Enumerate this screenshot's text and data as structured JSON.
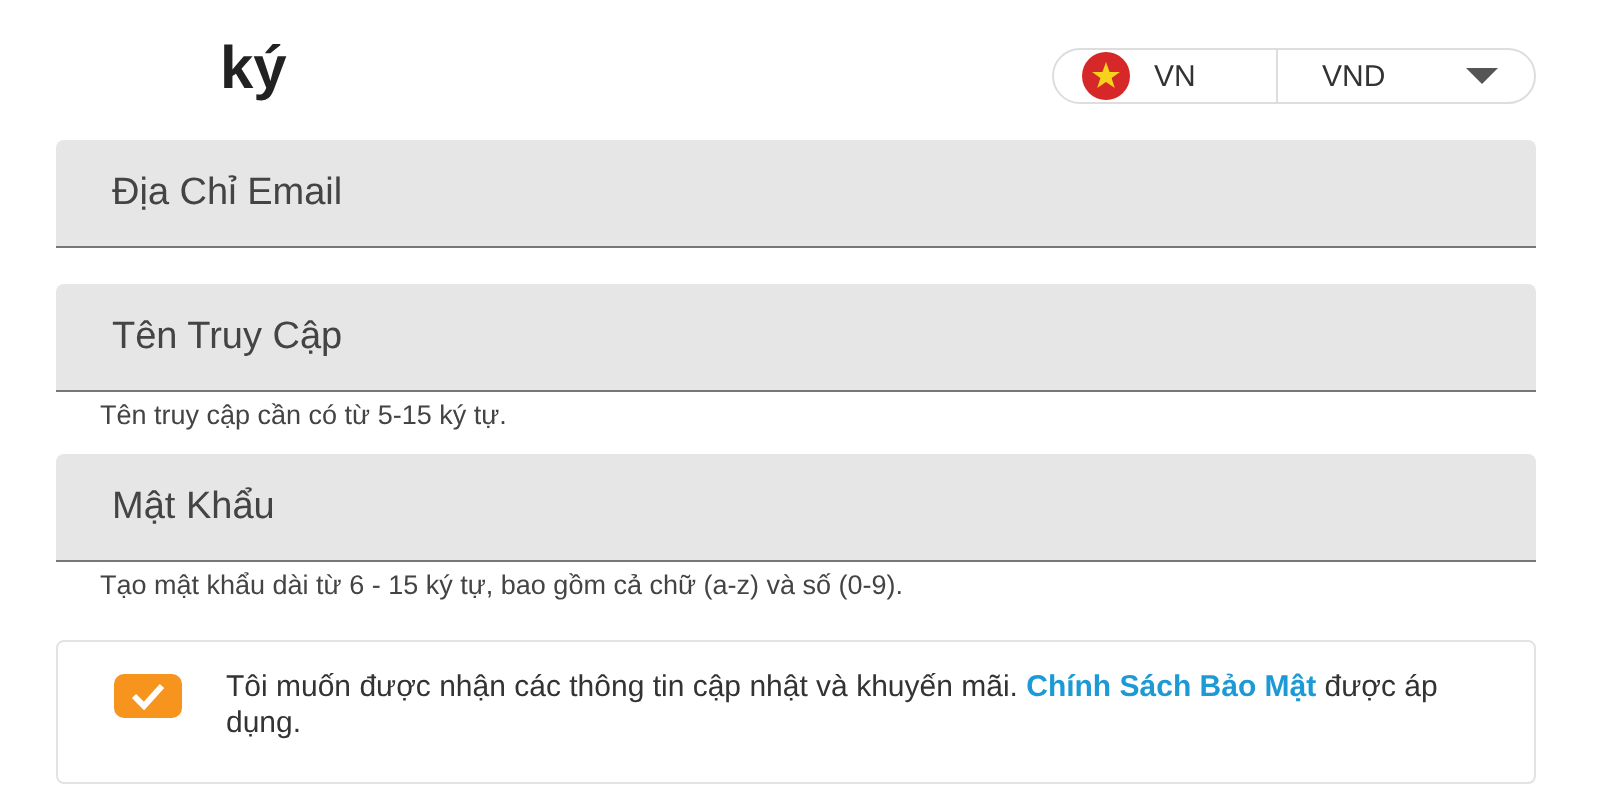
{
  "header": {
    "title": "ký",
    "locale": {
      "country": "VN",
      "currency": "VND"
    }
  },
  "fields": [
    {
      "placeholder": "Địa Chỉ Email"
    },
    {
      "placeholder": "Tên Truy Cập",
      "hint": "Tên truy cập cần có từ 5-15 ký tự."
    },
    {
      "placeholder": "Mật Khẩu",
      "hint": "Tạo mật khẩu dài từ 6 - 15 ký tự, bao gồm cả chữ (a-z) và số (0-9)."
    }
  ],
  "consent": {
    "checked": true,
    "text_before": "Tôi muốn được nhận các thông tin cập nhật và khuyến mãi. ",
    "link": "Chính Sách Bảo Mật",
    "text_after": " được áp dụng."
  }
}
